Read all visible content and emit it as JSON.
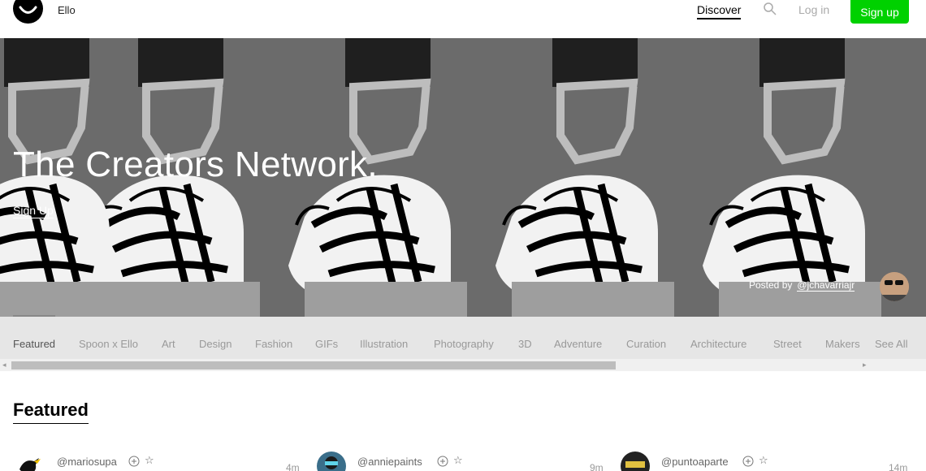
{
  "header": {
    "brand": "Ello",
    "discover": "Discover",
    "login": "Log in",
    "signup": "Sign up"
  },
  "hero": {
    "title": "The Creators Network.",
    "signup_link": "Sign Up",
    "posted_by_label": "Posted by",
    "posted_by_handle": "@jchavarriajr"
  },
  "categories": [
    "Featured",
    "Spoon x Ello",
    "Art",
    "Design",
    "Fashion",
    "GIFs",
    "Illustration",
    "Photography",
    "3D",
    "Adventure",
    "Curation",
    "Architecture",
    "Street",
    "Makers",
    "See All"
  ],
  "featured": {
    "title": "Featured"
  },
  "posts": [
    {
      "handle": "@mariosupa",
      "age": "4m"
    },
    {
      "handle": "@anniepaints",
      "age": "9m"
    },
    {
      "handle": "@puntoaparte",
      "age": "14m"
    }
  ],
  "colors": {
    "accent": "#00d100",
    "hero_bg": "#6b6b6b",
    "catbar_bg": "#e6e6e6"
  }
}
